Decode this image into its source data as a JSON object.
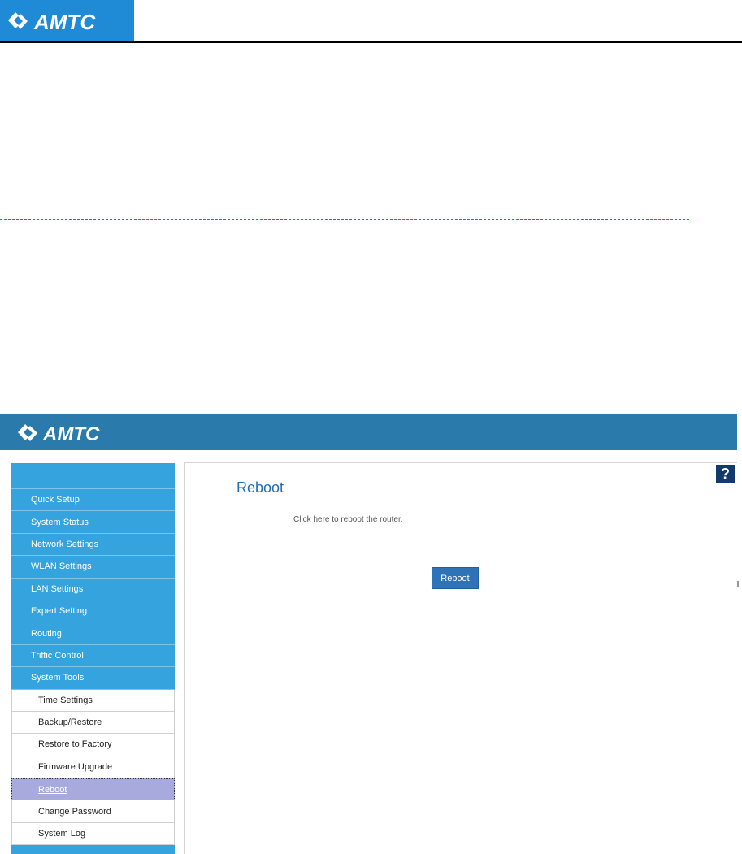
{
  "brand": {
    "logo_text": "AMTC",
    "logo_color": "#1f8bd6"
  },
  "router": {
    "sidebar": {
      "items": [
        "Quick Setup",
        "System Status",
        "Network Settings",
        "WLAN Settings",
        "LAN Settings",
        "Expert Setting",
        "Routing",
        "Triffic Control",
        "System Tools"
      ],
      "subitems": [
        "Time Settings",
        "Backup/Restore",
        "Restore to Factory",
        "Firmware Upgrade",
        "Reboot",
        "Change Password",
        "System Log"
      ],
      "active_subitem": "Reboot"
    },
    "content": {
      "title": "Reboot",
      "description": "Click here to reboot the router.",
      "button_label": "Reboot",
      "help_label": "?"
    }
  },
  "colors": {
    "header_bar": "#2b7aac",
    "sidebar_item": "#35a3dd",
    "active_item": "#a8aade",
    "button": "#2e72b8"
  }
}
